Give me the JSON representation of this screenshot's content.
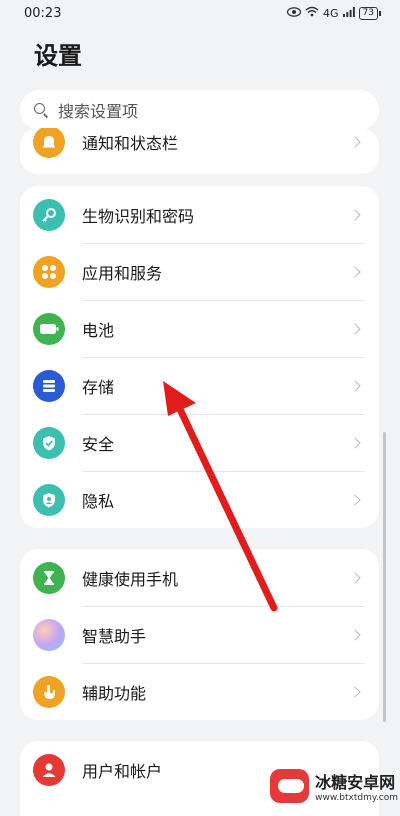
{
  "status_bar": {
    "time": "00:23",
    "signal": "4G",
    "battery": "73"
  },
  "page_title": "设置",
  "search": {
    "placeholder": "搜索设置项"
  },
  "cards": [
    {
      "items": [
        {
          "id": "notifications",
          "label": "通知和状态栏",
          "icon": "bell-icon",
          "color": "#f0a322"
        }
      ]
    },
    {
      "items": [
        {
          "id": "biometrics",
          "label": "生物识别和密码",
          "icon": "key-icon",
          "color": "#3cbfae"
        },
        {
          "id": "apps",
          "label": "应用和服务",
          "icon": "grid-icon",
          "color": "#f0a322"
        },
        {
          "id": "battery",
          "label": "电池",
          "icon": "battery-icon",
          "color": "#3fb34f"
        },
        {
          "id": "storage",
          "label": "存储",
          "icon": "storage-icon",
          "color": "#2a5bd7"
        },
        {
          "id": "security",
          "label": "安全",
          "icon": "shield-check-icon",
          "color": "#3cbfae"
        },
        {
          "id": "privacy",
          "label": "隐私",
          "icon": "privacy-shield-icon",
          "color": "#3cbfae"
        }
      ]
    },
    {
      "items": [
        {
          "id": "digital-balance",
          "label": "健康使用手机",
          "icon": "hourglass-icon",
          "color": "#3fb34f"
        },
        {
          "id": "assistant",
          "label": "智慧助手",
          "icon": "assistant-orb-icon",
          "color": "#a7a1f5"
        },
        {
          "id": "accessibility",
          "label": "辅助功能",
          "icon": "hand-icon",
          "color": "#f0a322"
        }
      ]
    },
    {
      "items": [
        {
          "id": "accounts",
          "label": "用户和帐户",
          "icon": "user-icon",
          "color": "#e53935"
        }
      ]
    }
  ],
  "watermark": {
    "title": "冰糖安卓网",
    "url": "www.btxtdmy.com"
  }
}
